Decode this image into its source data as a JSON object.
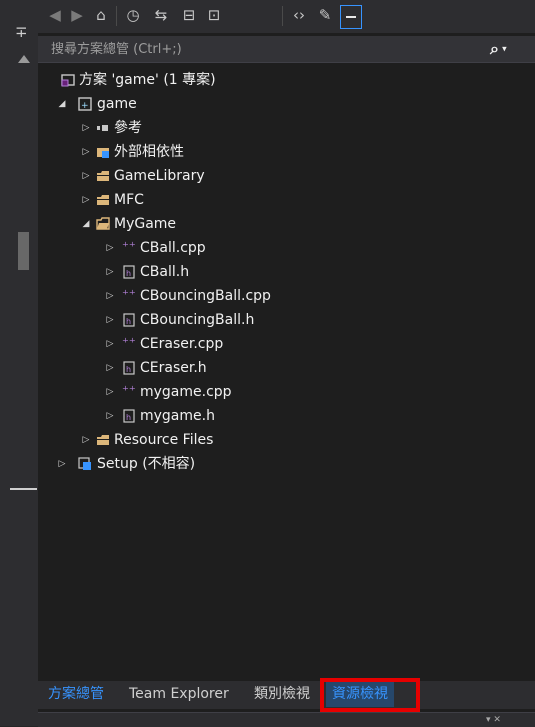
{
  "search": {
    "placeholder": "搜尋方案總管 (Ctrl+;)"
  },
  "tree": {
    "solution": "方案 'game' (1 專案)",
    "project": "game",
    "nodes": [
      {
        "label": "參考"
      },
      {
        "label": "外部相依性"
      },
      {
        "label": "GameLibrary"
      },
      {
        "label": "MFC"
      },
      {
        "label": "MyGame"
      },
      {
        "label": "CBall.cpp"
      },
      {
        "label": "CBall.h"
      },
      {
        "label": "CBouncingBall.cpp"
      },
      {
        "label": "CBouncingBall.h"
      },
      {
        "label": "CEraser.cpp"
      },
      {
        "label": "CEraser.h"
      },
      {
        "label": "mygame.cpp"
      },
      {
        "label": "mygame.h"
      },
      {
        "label": "Resource Files"
      },
      {
        "label": "Setup (不相容)"
      }
    ]
  },
  "tabs": [
    {
      "label": "方案總管"
    },
    {
      "label": "Team Explorer"
    },
    {
      "label": "類別檢視"
    },
    {
      "label": "資源檢視"
    }
  ],
  "colors": {
    "accent": "#3794ff",
    "highlight_box": "#e60000",
    "folder": "#dcb67a"
  }
}
